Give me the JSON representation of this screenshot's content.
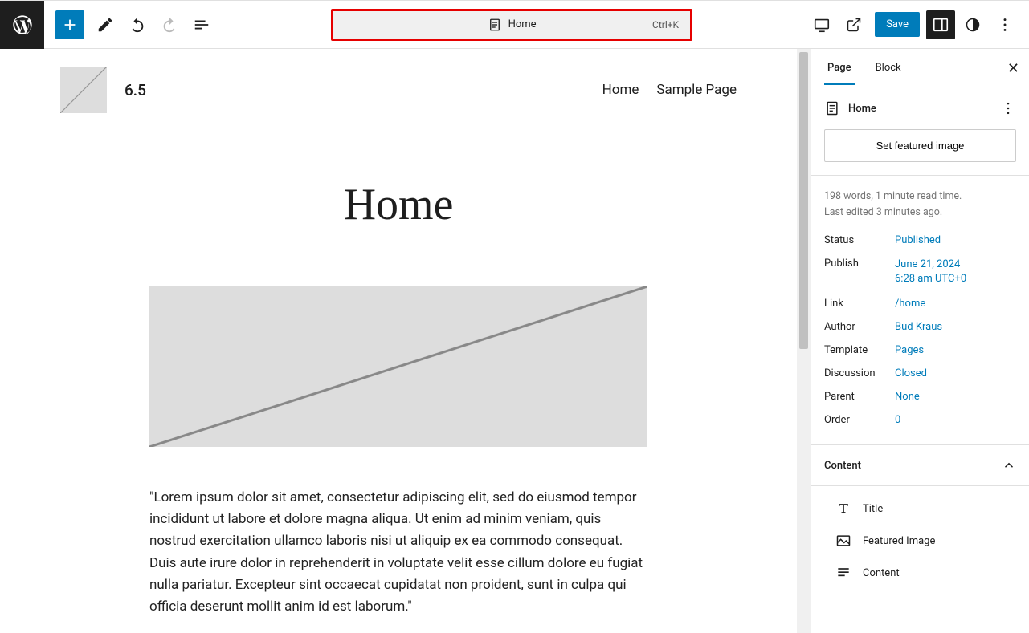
{
  "toolbar": {
    "document_title": "Home",
    "shortcut": "Ctrl+K",
    "save_label": "Save"
  },
  "canvas": {
    "site_title": "6.5",
    "nav": [
      "Home",
      "Sample Page"
    ],
    "page_title": "Home",
    "body": "\"Lorem ipsum dolor sit amet, consectetur adipiscing elit, sed do eiusmod tempor incididunt ut labore et dolore magna aliqua. Ut enim ad minim veniam, quis nostrud exercitation ullamco laboris nisi ut aliquip ex ea commodo consequat. Duis aute irure dolor in reprehenderit in voluptate velit esse cillum dolore eu fugiat nulla pariatur. Excepteur sint occaecat cupidatat non proident, sunt in culpa qui officia deserunt mollit anim id est laborum.\""
  },
  "sidebar": {
    "tabs": [
      "Page",
      "Block"
    ],
    "summary_title": "Home",
    "featured_btn": "Set featured image",
    "stats": "198 words, 1 minute read time.",
    "last_edited": "Last edited 3 minutes ago.",
    "meta": {
      "status_label": "Status",
      "status_value": "Published",
      "publish_label": "Publish",
      "publish_date": "June 21, 2024",
      "publish_time": "6:28 am UTC+0",
      "link_label": "Link",
      "link_value": "/home",
      "author_label": "Author",
      "author_value": "Bud Kraus",
      "template_label": "Template",
      "template_value": "Pages",
      "discussion_label": "Discussion",
      "discussion_value": "Closed",
      "parent_label": "Parent",
      "parent_value": "None",
      "order_label": "Order",
      "order_value": "0"
    },
    "content_panel": "Content",
    "content_items": [
      "Title",
      "Featured Image",
      "Content"
    ]
  }
}
